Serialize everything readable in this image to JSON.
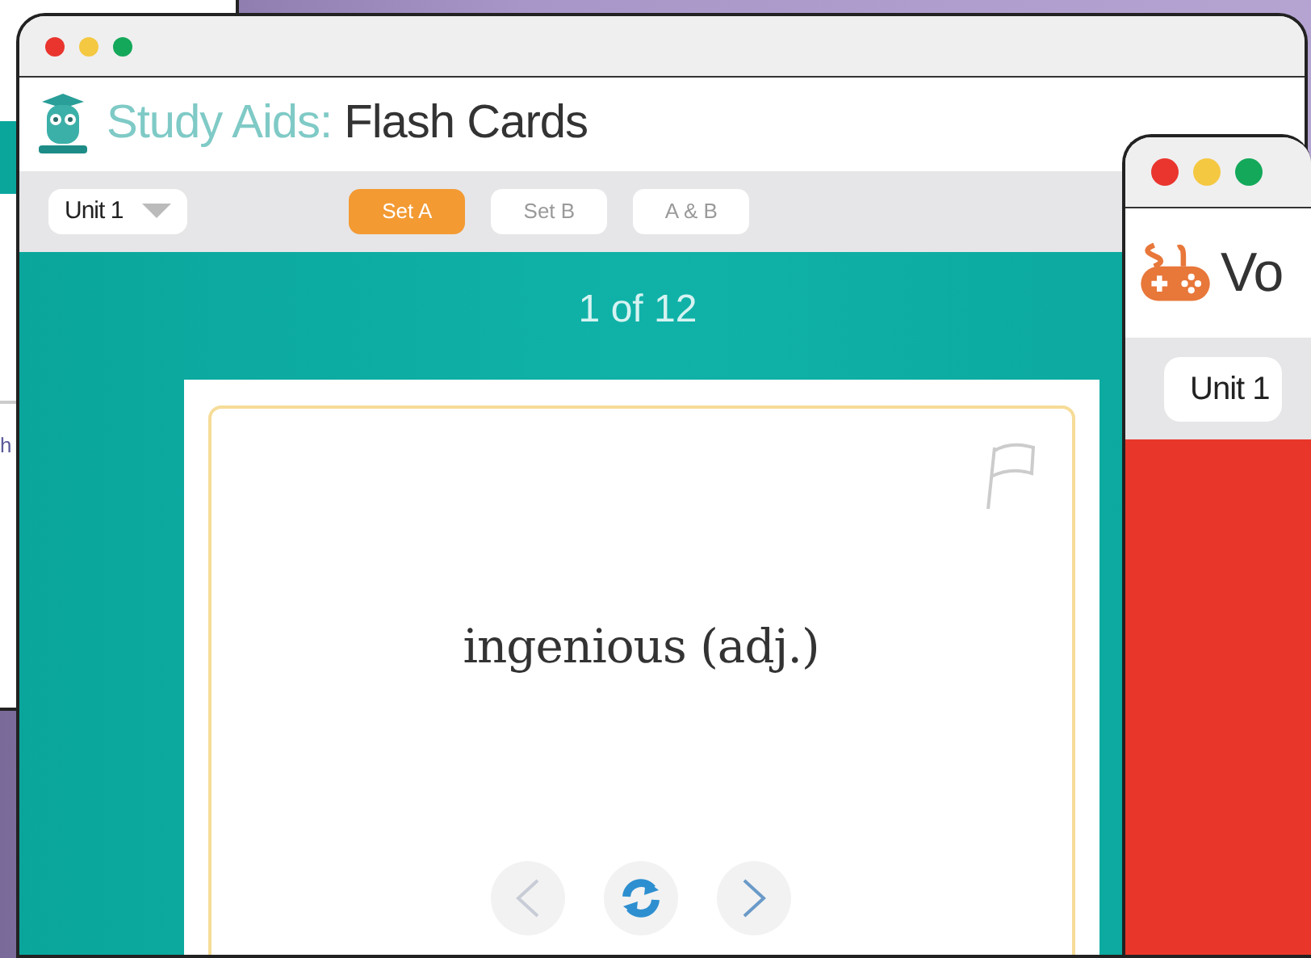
{
  "back_window": {
    "text": "h"
  },
  "main_window": {
    "title_parts": [
      {
        "text": "Study Aids:",
        "kind": "accent"
      },
      {
        "text": "Flash Cards",
        "kind": "plain"
      }
    ],
    "unit_select": "Unit 1",
    "sets": [
      {
        "label": "Set A",
        "selected": true
      },
      {
        "label": "Set B",
        "selected": false
      },
      {
        "label": "A & B",
        "selected": false
      }
    ],
    "counter": "1 of 12",
    "card": {
      "term": "ingenious (adj.)"
    }
  },
  "side_window": {
    "title": "Vo",
    "unit_select": "Unit 1"
  }
}
